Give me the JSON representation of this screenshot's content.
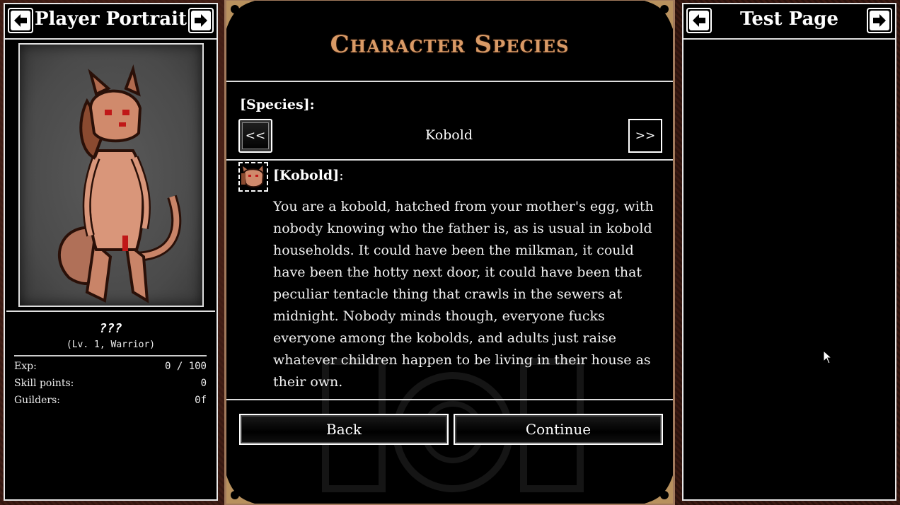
{
  "left_panel": {
    "title": "Player Portrait",
    "character": {
      "name": "???",
      "subtitle": "(Lv. 1, Warrior)"
    },
    "stats": [
      {
        "label": "Exp:",
        "value": "0 / 100"
      },
      {
        "label": "Skill points:",
        "value": "0"
      },
      {
        "label": "Guilders:",
        "value": "0f"
      }
    ]
  },
  "center_panel": {
    "title": "Character Species",
    "species_label": "[Species]:",
    "prev_label": "<<",
    "next_label": ">>",
    "species_value": "Kobold",
    "species_heading": "[Kobold]",
    "species_heading_suffix": ":",
    "species_description": "You are a kobold, hatched from your mother's egg, with nobody knowing who the father is, as is usual in kobold households. It could have been the milkman, it could have been the hotty next door, it could have been that peculiar tentacle thing that crawls in the sewers at midnight. Nobody minds though, everyone fucks everyone among the kobolds, and adults just raise whatever children happen to be living in their house as their own.",
    "back_label": "Back",
    "continue_label": "Continue"
  },
  "right_panel": {
    "title": "Test Page"
  },
  "colors": {
    "title_accent": "#d99a66",
    "frame_border": "#a27a5c",
    "panel_bg": "#000000"
  },
  "icons": [
    "arrow-left-icon",
    "arrow-right-icon",
    "kobold-species-icon",
    "mouse-cursor-icon"
  ]
}
